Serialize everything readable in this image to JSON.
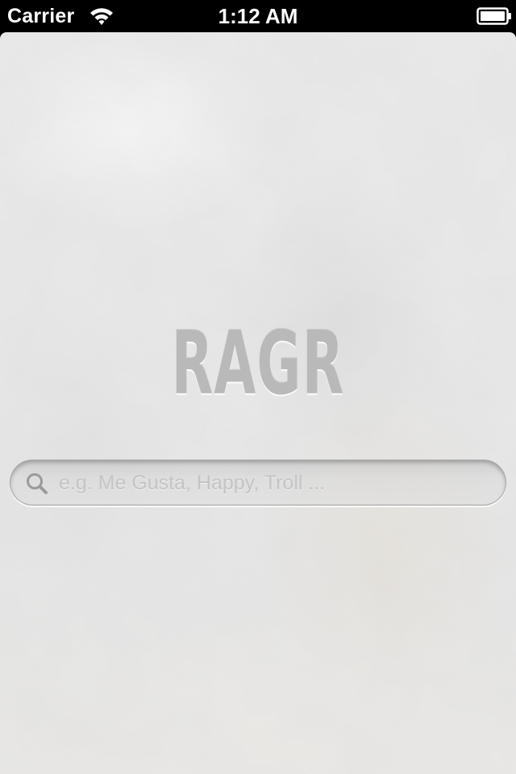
{
  "status_bar": {
    "carrier": "Carrier",
    "time": "1:12 AM",
    "wifi_icon": "wifi-icon",
    "battery_icon": "battery-icon"
  },
  "app": {
    "title": "RAGR"
  },
  "search": {
    "placeholder": "e.g. Me Gusta, Happy, Troll ...",
    "value": "",
    "icon": "search-icon"
  },
  "colors": {
    "background": "#eaeaea",
    "logo": "#b9b9b9",
    "status_bar": "#000000",
    "placeholder": "#c4c4c4"
  }
}
